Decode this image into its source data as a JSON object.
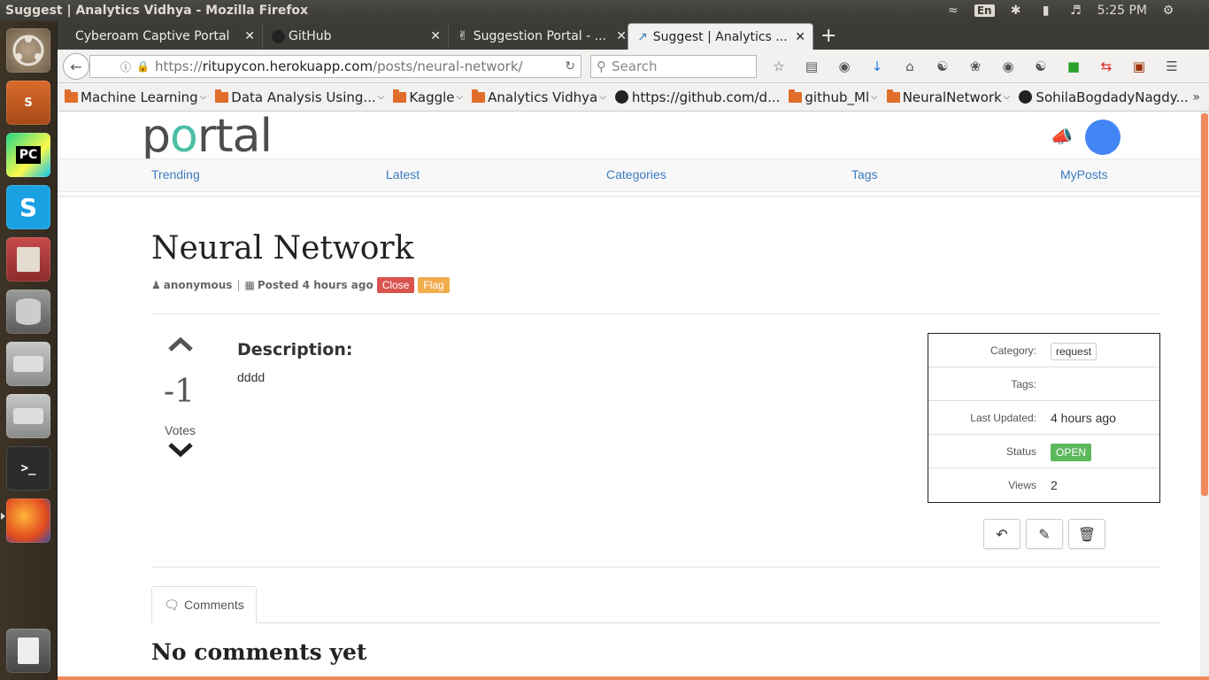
{
  "os": {
    "window_title": "Suggest | Analytics Vidhya - Mozilla Firefox",
    "keyboard_lang": "En",
    "clock": "5:25 PM"
  },
  "browser": {
    "tabs": [
      {
        "label": "Cyberoam Captive Portal"
      },
      {
        "label": "GitHub"
      },
      {
        "label": "Suggestion Portal - ..."
      },
      {
        "label": "Suggest | Analytics ..."
      }
    ],
    "url_scheme": "https://",
    "url_host": "ritupycon.herokuapp.com",
    "url_path": "/posts/neural-network/",
    "search_placeholder": "Search",
    "bookmarks": [
      {
        "label": "Machine Learning",
        "kind": "folder"
      },
      {
        "label": "Data Analysis Using...",
        "kind": "folder"
      },
      {
        "label": "Kaggle",
        "kind": "folder"
      },
      {
        "label": "Analytics Vidhya",
        "kind": "folder"
      },
      {
        "label": "https://github.com/d...",
        "kind": "github"
      },
      {
        "label": "github_Ml",
        "kind": "folder"
      },
      {
        "label": "NeuralNetwork",
        "kind": "folder"
      },
      {
        "label": "SohilaBogdadyNagdy...",
        "kind": "github"
      }
    ]
  },
  "site": {
    "logo": {
      "p": "p",
      "o": "o",
      "rest": "rtal"
    },
    "nav": [
      "Trending",
      "Latest",
      "Categories",
      "Tags",
      "MyPosts"
    ],
    "accent": "#4cbfa5",
    "link_color": "#3b7bbf"
  },
  "post": {
    "title": "Neural Network",
    "author": "anonymous",
    "posted": "Posted 4 hours ago",
    "close_label": "Close",
    "flag_label": "Flag",
    "votes": "-1",
    "votes_label": "Votes",
    "description_heading": "Description:",
    "description": "dddd",
    "info": {
      "category_key": "Category:",
      "category_val": "request",
      "tags_key": "Tags:",
      "tags_val": "",
      "updated_key": "Last Updated:",
      "updated_val": "4 hours ago",
      "status_key": "Status",
      "status_val": "OPEN",
      "views_key": "Views",
      "views_val": "2"
    }
  },
  "comments": {
    "tab_label": "Comments",
    "empty_text": "No comments yet"
  }
}
